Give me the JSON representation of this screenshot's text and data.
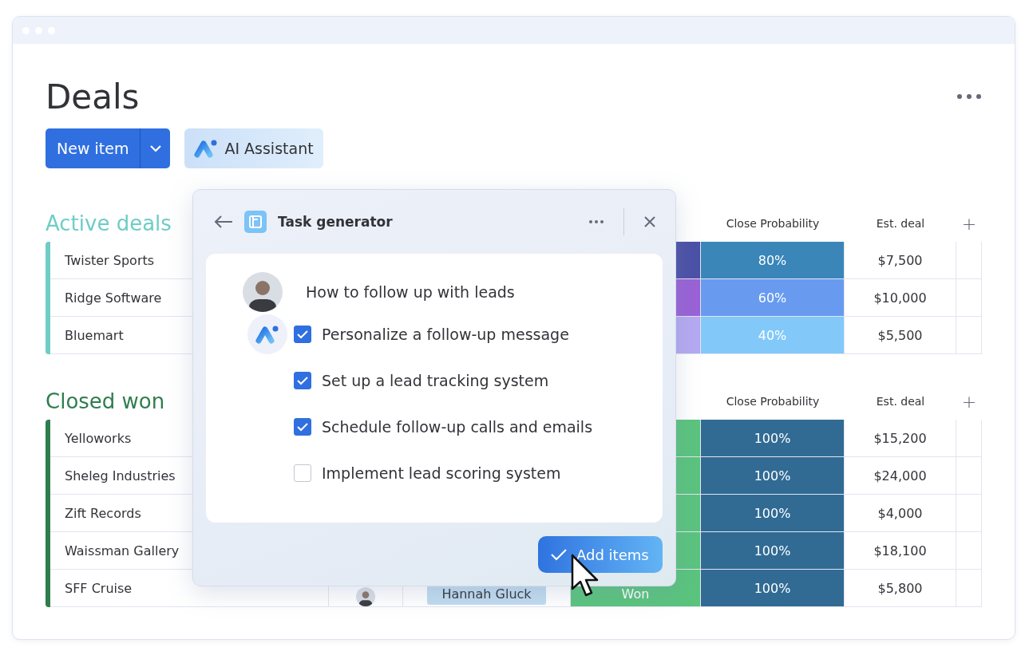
{
  "page": {
    "title": "Deals"
  },
  "toolbar": {
    "new_item": "New item",
    "ai_assistant": "AI Assistant"
  },
  "groups": [
    {
      "title": "Active deals",
      "color": "#6fcdc6",
      "columns": [
        "Close Probability",
        "Est. deal",
        "+"
      ],
      "rows": [
        {
          "name": "Twister Sports",
          "status": {
            "color": "#4b51a6"
          },
          "probability": {
            "label": "80%",
            "color": "#3a86b8"
          },
          "est_deal": "$7,500"
        },
        {
          "name": "Ridge Software",
          "status": {
            "color": "#9a62d6"
          },
          "probability": {
            "label": "60%",
            "color": "#689bf0"
          },
          "est_deal": "$10,000"
        },
        {
          "name": "Bluemart",
          "status": {
            "color": "#b5a9f1"
          },
          "probability": {
            "label": "40%",
            "color": "#82c9f9"
          },
          "est_deal": "$5,500"
        }
      ]
    },
    {
      "title": "Closed won",
      "color": "#2f7d4f",
      "columns": [
        "Close Probability",
        "Est. deal",
        "+"
      ],
      "rows": [
        {
          "name": "Yelloworks",
          "status": {
            "color": "#5ac47d"
          },
          "probability": {
            "label": "100%",
            "color": "#316b94"
          },
          "est_deal": "$15,200"
        },
        {
          "name": "Sheleg Industries",
          "status": {
            "color": "#5ac47d"
          },
          "probability": {
            "label": "100%",
            "color": "#316b94"
          },
          "est_deal": "$24,000"
        },
        {
          "name": "Zift Records",
          "status": {
            "color": "#5ac47d"
          },
          "probability": {
            "label": "100%",
            "color": "#316b94"
          },
          "est_deal": "$4,000"
        },
        {
          "name": "Waissman Gallery",
          "status": {
            "color": "#5ac47d"
          },
          "probability": {
            "label": "100%",
            "color": "#316b94"
          },
          "est_deal": "$18,100"
        },
        {
          "name": "SFF Cruise",
          "owner": "Hannah Gluck",
          "status": {
            "color": "#5ac47d",
            "label": "Won"
          },
          "probability": {
            "label": "100%",
            "color": "#316b94"
          },
          "est_deal": "$5,800"
        }
      ]
    }
  ],
  "popup": {
    "title": "Task generator",
    "prompt": "How to follow up with leads",
    "tasks": [
      {
        "label": "Personalize a follow-up message",
        "checked": true
      },
      {
        "label": "Set up a lead tracking system",
        "checked": true
      },
      {
        "label": "Schedule follow-up calls and emails",
        "checked": true
      },
      {
        "label": "Implement lead scoring system",
        "checked": false
      }
    ],
    "button": "Add items"
  }
}
